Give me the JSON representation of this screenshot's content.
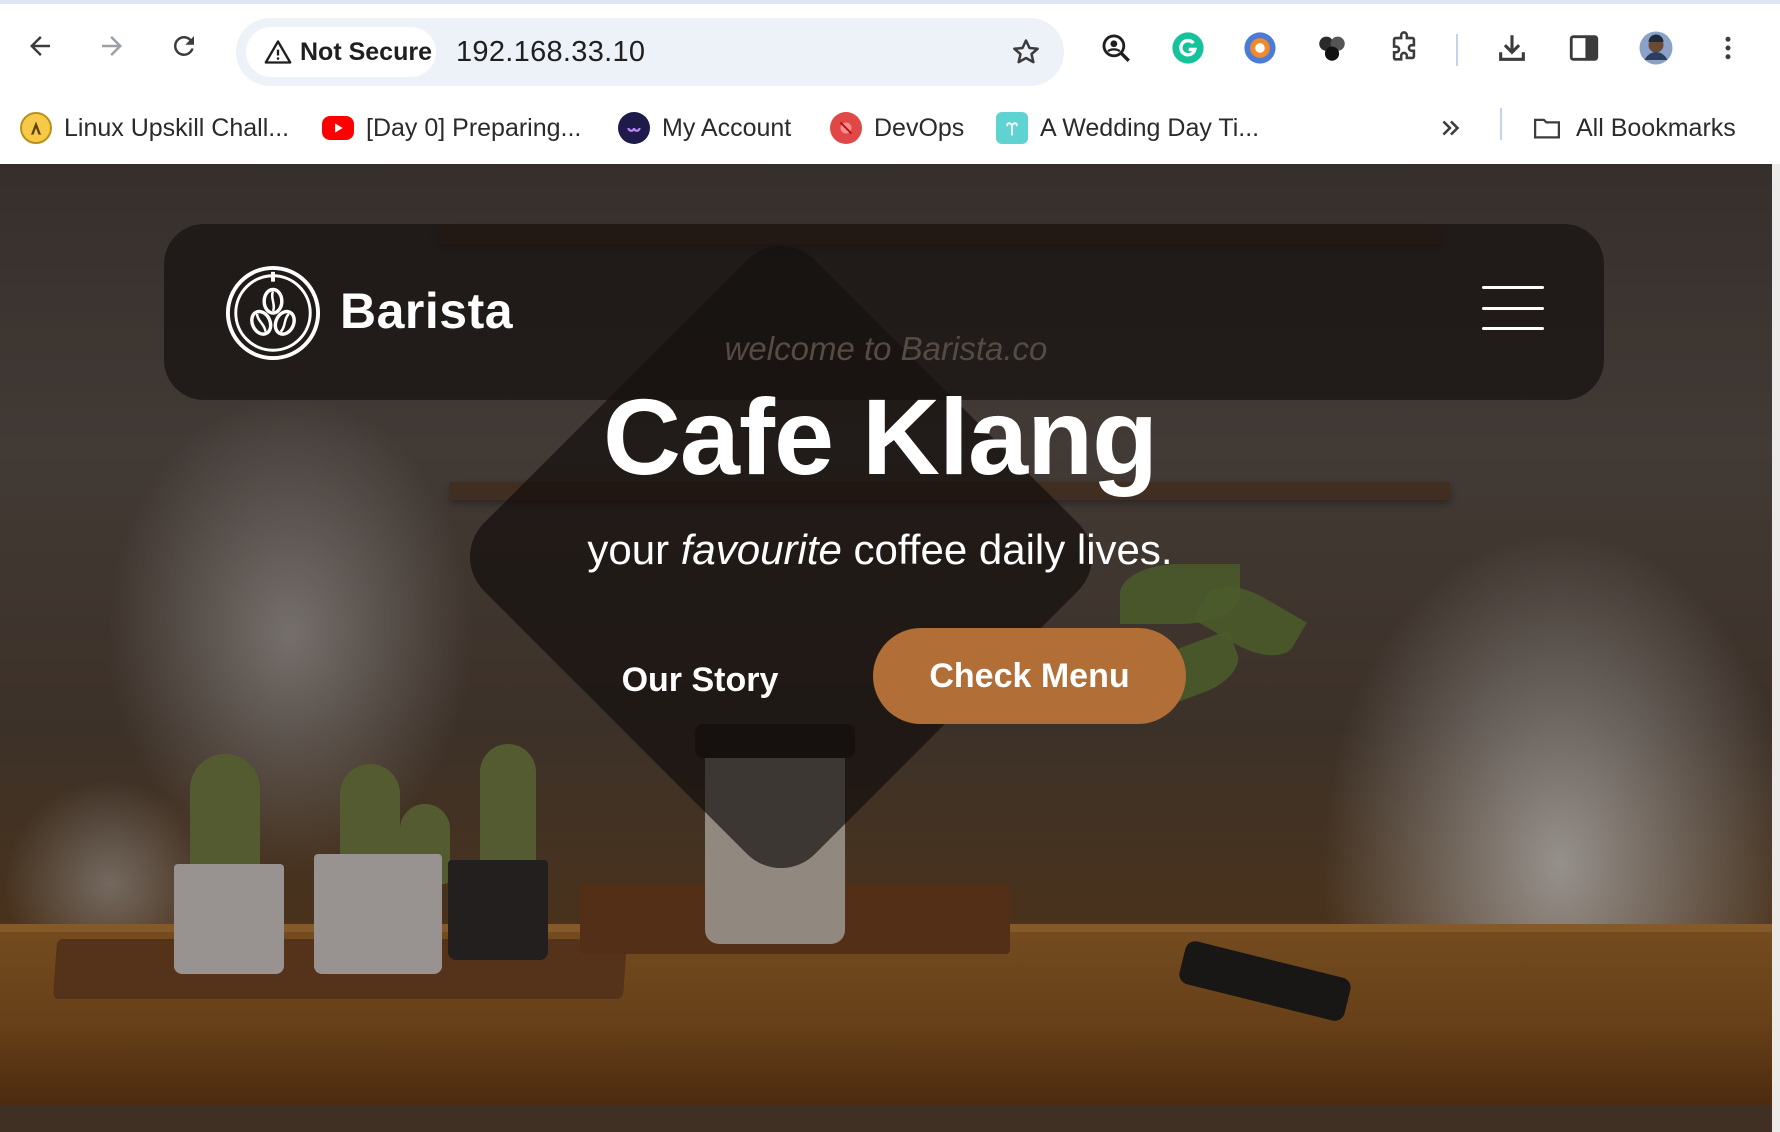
{
  "browser": {
    "security_label": "Not Secure",
    "url": "192.168.33.10",
    "icons": [
      "back-arrow-icon",
      "forward-arrow-icon",
      "reload-icon",
      "warning-icon",
      "star-icon",
      "lens-search-icon",
      "grammarly-icon",
      "extension-orange-icon",
      "extension-circles-icon",
      "puzzle-icon",
      "download-icon",
      "side-panel-icon",
      "profile-avatar",
      "more-vertical-icon"
    ]
  },
  "bookmarks": {
    "items": [
      {
        "label": "Linux Upskill Chall...",
        "icon": "linux-favicon"
      },
      {
        "label": "[Day 0] Preparing...",
        "icon": "youtube-favicon"
      },
      {
        "label": "My Account",
        "icon": "account-favicon"
      },
      {
        "label": "DevOps",
        "icon": "devops-favicon"
      },
      {
        "label": "A Wedding Day Ti...",
        "icon": "wedding-favicon"
      }
    ],
    "all_bookmarks_label": "All Bookmarks"
  },
  "site": {
    "brand": "Barista",
    "welcome": "welcome to Barista.co",
    "title": "Cafe Klang",
    "subtitle_before": "your ",
    "subtitle_em": "favourite",
    "subtitle_after": " coffee daily lives.",
    "btn_story": "Our Story",
    "btn_menu": "Check Menu",
    "colors": {
      "accent": "#b16e36",
      "navbar": "#161210",
      "text": "#ffffff"
    }
  }
}
